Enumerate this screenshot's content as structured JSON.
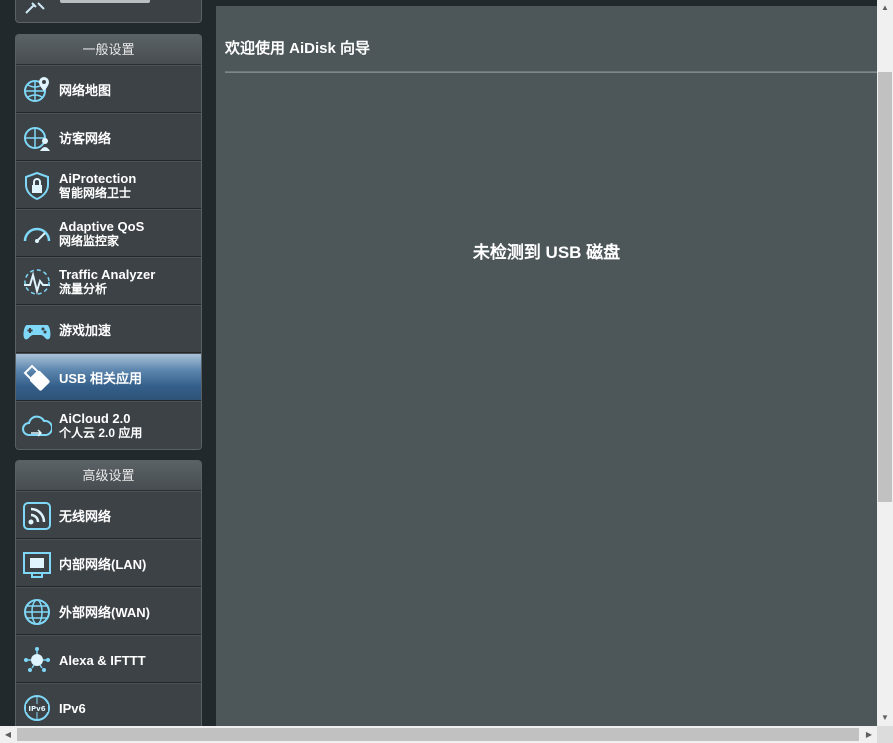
{
  "menu": {
    "general": {
      "header": "一般设置",
      "items": [
        {
          "main": "网络地图",
          "sub": "",
          "icon": "globe-pin-icon"
        },
        {
          "main": "访客网络",
          "sub": "",
          "icon": "guest-network-icon"
        },
        {
          "main": "AiProtection",
          "sub": "智能网络卫士",
          "icon": "shield-lock-icon"
        },
        {
          "main": "Adaptive QoS",
          "sub": "网络监控家",
          "icon": "speedometer-icon"
        },
        {
          "main": "Traffic Analyzer",
          "sub": "流量分析",
          "icon": "traffic-analyzer-icon"
        },
        {
          "main": "游戏加速",
          "sub": "",
          "icon": "gamepad-icon"
        },
        {
          "main": "USB 相关应用",
          "sub": "",
          "icon": "usb-stick-icon",
          "active": true
        },
        {
          "main": "AiCloud 2.0",
          "sub": "个人云 2.0 应用",
          "icon": "cloud-icon"
        }
      ]
    },
    "advanced": {
      "header": "高级设置",
      "items": [
        {
          "main": "无线网络",
          "sub": "",
          "icon": "wireless-icon"
        },
        {
          "main": "内部网络(LAN)",
          "sub": "",
          "icon": "lan-icon"
        },
        {
          "main": "外部网络(WAN)",
          "sub": "",
          "icon": "wan-globe-icon"
        },
        {
          "main": "Alexa & IFTTT",
          "sub": "",
          "icon": "alexa-icon"
        },
        {
          "main": "IPv6",
          "sub": "",
          "icon": "ipv6-icon"
        }
      ]
    }
  },
  "content": {
    "title": "欢迎使用 AiDisk 向导",
    "message": "未检测到 USB 磁盘"
  },
  "colors": {
    "accent": "#5d86ae",
    "content_bg": "#4d5659",
    "icon_cyan": "#6fd3f5"
  }
}
